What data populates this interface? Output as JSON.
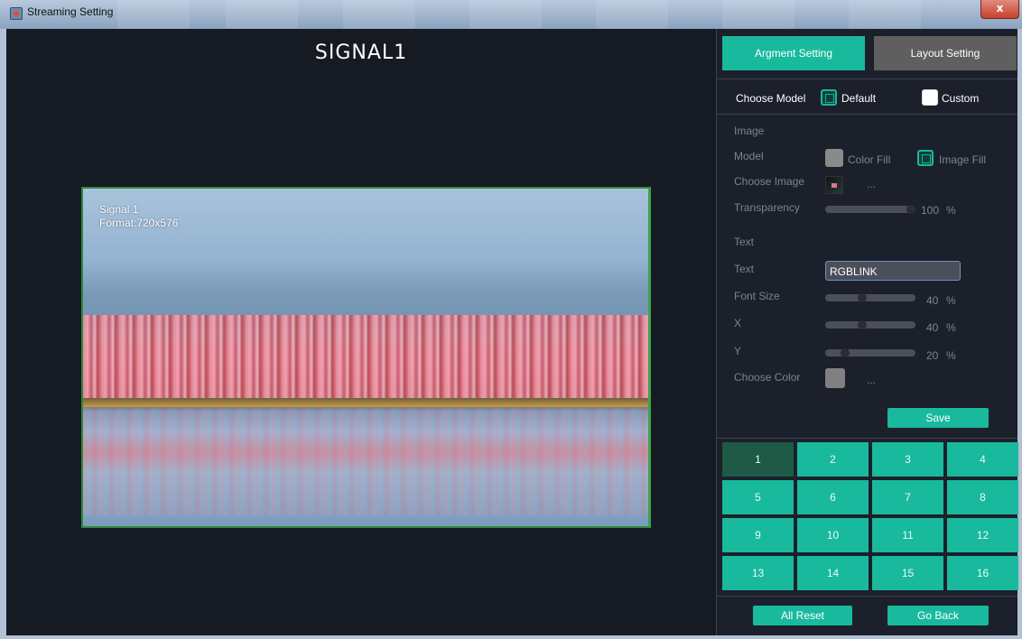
{
  "window": {
    "title": "Streaming Setting",
    "close_label": "x"
  },
  "preview": {
    "signal_title": "SIGNAL1",
    "overlay_name": "Signal 1",
    "overlay_format": "Format:720x576"
  },
  "tabs": [
    {
      "label": "Argment Setting",
      "active": true
    },
    {
      "label": "Layout Setting",
      "active": false
    }
  ],
  "choose_model": {
    "label": "Choose Model",
    "default_label": "Default",
    "custom_label": "Custom",
    "selected": "Default"
  },
  "image_section": {
    "heading": "Image",
    "model_label": "Model",
    "color_fill_label": "Color Fill",
    "image_fill_label": "Image Fill",
    "selected_fill": "Image Fill",
    "choose_image_label": "Choose Image",
    "browse_label": "...",
    "transparency_label": "Transparency",
    "transparency_value": "100",
    "transparency_unit": "%",
    "transparency_fraction": 1.0
  },
  "text_section": {
    "heading": "Text",
    "text_label": "Text",
    "text_value": "RGBLINK",
    "font_size_label": "Font Size",
    "font_size_value": "40",
    "x_label": "X",
    "x_value": "40",
    "y_label": "Y",
    "y_value": "20",
    "unit": "%",
    "choose_color_label": "Choose Color",
    "browse_label": "...",
    "color": "#808080"
  },
  "save_label": "Save",
  "grid": {
    "selected": "1",
    "cells": [
      "1",
      "2",
      "3",
      "4",
      "5",
      "6",
      "7",
      "8",
      "9",
      "10",
      "11",
      "12",
      "13",
      "14",
      "15",
      "16"
    ]
  },
  "footer": {
    "all_reset_label": "All Reset",
    "go_back_label": "Go Back"
  },
  "colors": {
    "accent": "#19b99d",
    "selected_cell": "#1e5a45",
    "inactive_tab": "#5f5f5f",
    "panel_bg": "#1b202b"
  }
}
